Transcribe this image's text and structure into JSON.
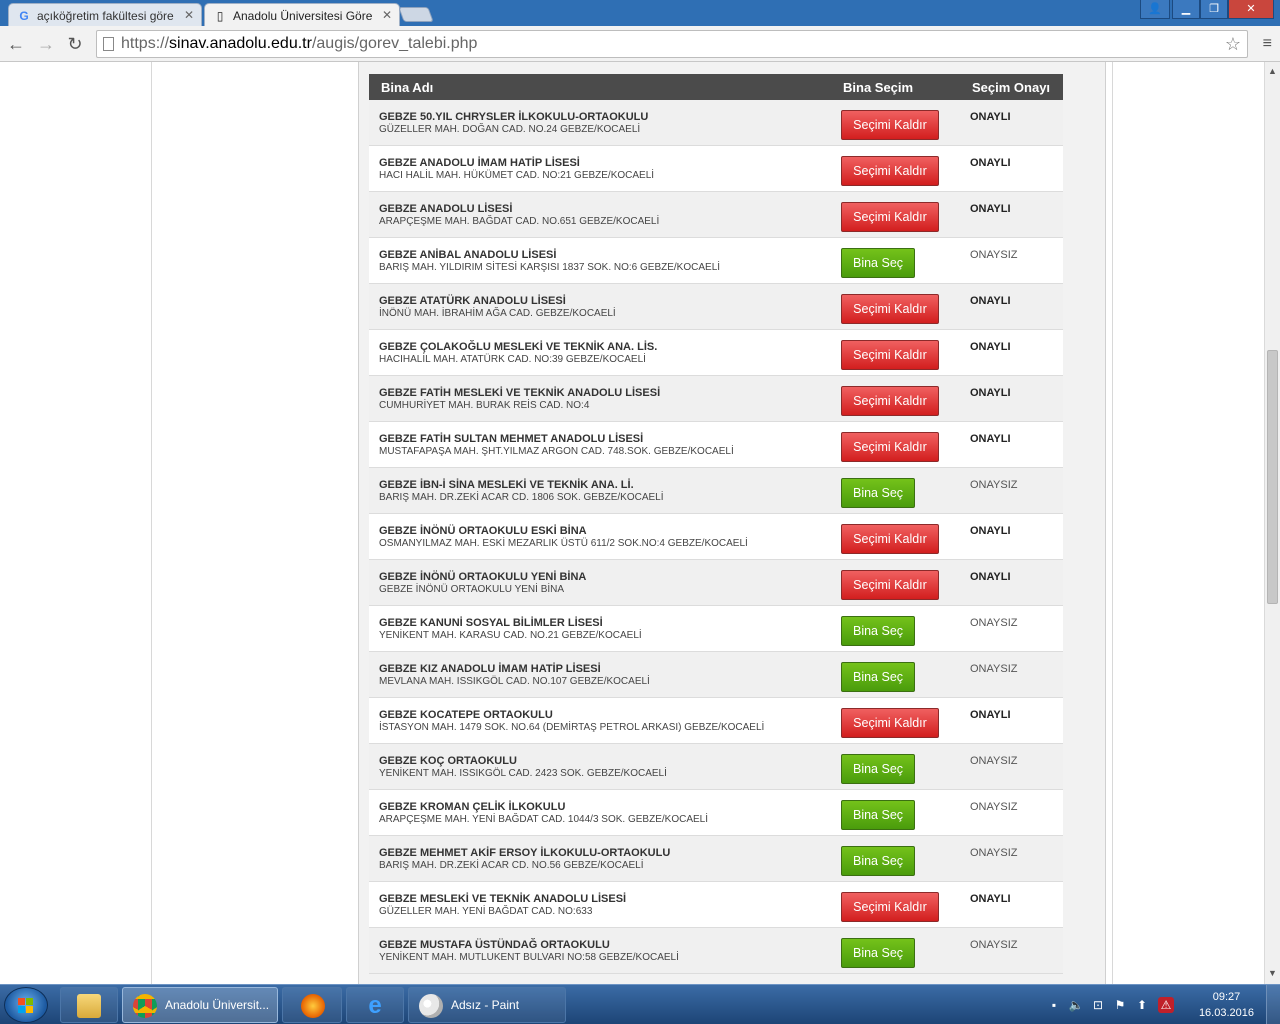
{
  "browser": {
    "tabs": [
      {
        "title": "açıköğretim fakültesi göre",
        "icon": "google-icon"
      },
      {
        "title": "Anadolu Üniversitesi Göre",
        "icon": "page-icon"
      }
    ],
    "url_scheme": "https://",
    "url_host": "sinav.anadolu.edu.tr",
    "url_path": "/augis/gorev_talebi.php"
  },
  "table": {
    "headers": {
      "name": "Bina Adı",
      "select": "Bina Seçim",
      "approval": "Seçim Onayı"
    },
    "rows": [
      {
        "name": "GEBZE 50.YIL CHRYSLER İLKOKULU-ORTAOKULU",
        "address": "GÜZELLER MAH. DOĞAN CAD. NO.24 GEBZE/KOCAELİ",
        "button": "Seçimi Kaldır",
        "status": "ONAYLI"
      },
      {
        "name": "GEBZE ANADOLU İMAM HATİP LİSESİ",
        "address": "HACI HALİL MAH. HÜKÜMET CAD. NO:21 GEBZE/KOCAELİ",
        "button": "Seçimi Kaldır",
        "status": "ONAYLI"
      },
      {
        "name": "GEBZE ANADOLU LİSESİ",
        "address": "ARAPÇEŞME MAH. BAĞDAT CAD. NO.651 GEBZE/KOCAELİ",
        "button": "Seçimi Kaldır",
        "status": "ONAYLI"
      },
      {
        "name": "GEBZE ANİBAL ANADOLU LİSESİ",
        "address": "BARIŞ MAH. YILDIRIM SİTESİ KARŞISI 1837 SOK. NO:6 GEBZE/KOCAELİ",
        "button": "Bina Seç",
        "status": "ONAYSIZ"
      },
      {
        "name": "GEBZE ATATÜRK ANADOLU LİSESİ",
        "address": "İNÖNÜ MAH. İBRAHİM AĞA CAD. GEBZE/KOCAELİ",
        "button": "Seçimi Kaldır",
        "status": "ONAYLI"
      },
      {
        "name": "GEBZE ÇOLAKOĞLU MESLEKİ VE TEKNİK ANA. LİS.",
        "address": "HACIHALİL MAH. ATATÜRK CAD. NO:39 GEBZE/KOCAELİ",
        "button": "Seçimi Kaldır",
        "status": "ONAYLI"
      },
      {
        "name": "GEBZE FATİH MESLEKİ VE TEKNİK ANADOLU LİSESİ",
        "address": "CUMHURİYET MAH. BURAK REİS CAD. NO:4",
        "button": "Seçimi Kaldır",
        "status": "ONAYLI"
      },
      {
        "name": "GEBZE FATİH SULTAN MEHMET ANADOLU LİSESİ",
        "address": "MUSTAFAPAŞA MAH. ŞHT.YILMAZ ARGON CAD. 748.SOK. GEBZE/KOCAELİ",
        "button": "Seçimi Kaldır",
        "status": "ONAYLI"
      },
      {
        "name": "GEBZE İBN-İ SİNA MESLEKİ VE TEKNİK ANA. Lİ.",
        "address": "BARIŞ MAH. DR.ZEKİ ACAR CD. 1806 SOK. GEBZE/KOCAELİ",
        "button": "Bina Seç",
        "status": "ONAYSIZ"
      },
      {
        "name": "GEBZE İNÖNÜ ORTAOKULU ESKİ BİNA",
        "address": "OSMANYILMAZ MAH. ESKİ MEZARLIK ÜSTÜ 611/2 SOK.NO:4 GEBZE/KOCAELİ",
        "button": "Seçimi Kaldır",
        "status": "ONAYLI"
      },
      {
        "name": "GEBZE İNÖNÜ ORTAOKULU YENİ BİNA",
        "address": "GEBZE İNÖNÜ ORTAOKULU YENİ BİNA",
        "button": "Seçimi Kaldır",
        "status": "ONAYLI"
      },
      {
        "name": "GEBZE KANUNİ SOSYAL BİLİMLER LİSESİ",
        "address": "YENİKENT MAH. KARASU CAD. NO.21 GEBZE/KOCAELİ",
        "button": "Bina Seç",
        "status": "ONAYSIZ"
      },
      {
        "name": "GEBZE KIZ ANADOLU İMAM HATİP LİSESİ",
        "address": "MEVLANA MAH. ISSIKGÖL CAD. NO.107 GEBZE/KOCAELİ",
        "button": "Bina Seç",
        "status": "ONAYSIZ"
      },
      {
        "name": "GEBZE KOCATEPE ORTAOKULU",
        "address": "İSTASYON MAH. 1479 SOK. NO.64 (DEMİRTAŞ PETROL ARKASI) GEBZE/KOCAELİ",
        "button": "Seçimi Kaldır",
        "status": "ONAYLI"
      },
      {
        "name": "GEBZE KOÇ ORTAOKULU",
        "address": "YENİKENT MAH. ISSIKGÖL CAD. 2423 SOK. GEBZE/KOCAELİ",
        "button": "Bina Seç",
        "status": "ONAYSIZ"
      },
      {
        "name": "GEBZE KROMAN ÇELİK İLKOKULU",
        "address": "ARAPÇEŞME MAH. YENİ BAĞDAT CAD. 1044/3 SOK. GEBZE/KOCAELİ",
        "button": "Bina Seç",
        "status": "ONAYSIZ"
      },
      {
        "name": "GEBZE MEHMET AKİF ERSOY İLKOKULU-ORTAOKULU",
        "address": "BARIŞ MAH. DR.ZEKİ ACAR CD. NO.56 GEBZE/KOCAELİ",
        "button": "Bina Seç",
        "status": "ONAYSIZ"
      },
      {
        "name": "GEBZE MESLEKİ VE TEKNİK ANADOLU LİSESİ",
        "address": "GÜZELLER MAH. YENİ BAĞDAT CAD. NO:633",
        "button": "Seçimi Kaldır",
        "status": "ONAYLI"
      },
      {
        "name": "GEBZE MUSTAFA ÜSTÜNDAĞ ORTAOKULU",
        "address": "YENİKENT MAH. MUTLUKENT BULVARI NO:58 GEBZE/KOCAELİ",
        "button": "Bina Seç",
        "status": "ONAYSIZ"
      }
    ]
  },
  "taskbar": {
    "items": [
      {
        "label": "",
        "icon": "folder-icon"
      },
      {
        "label": "Anadolu Üniversit...",
        "icon": "chrome-icon"
      },
      {
        "label": "",
        "icon": "firefox-icon"
      },
      {
        "label": "",
        "icon": "internet-explorer-icon"
      },
      {
        "label": "Adsız - Paint",
        "icon": "paint-icon"
      }
    ],
    "time": "09:27",
    "date": "16.03.2016"
  },
  "colors": {
    "remove_button": "#d21e1e",
    "select_button": "#4a9c0c",
    "header_bg": "#4b4b4b",
    "titlebar": "#2f6fb4",
    "taskbar": "#1d4576"
  }
}
